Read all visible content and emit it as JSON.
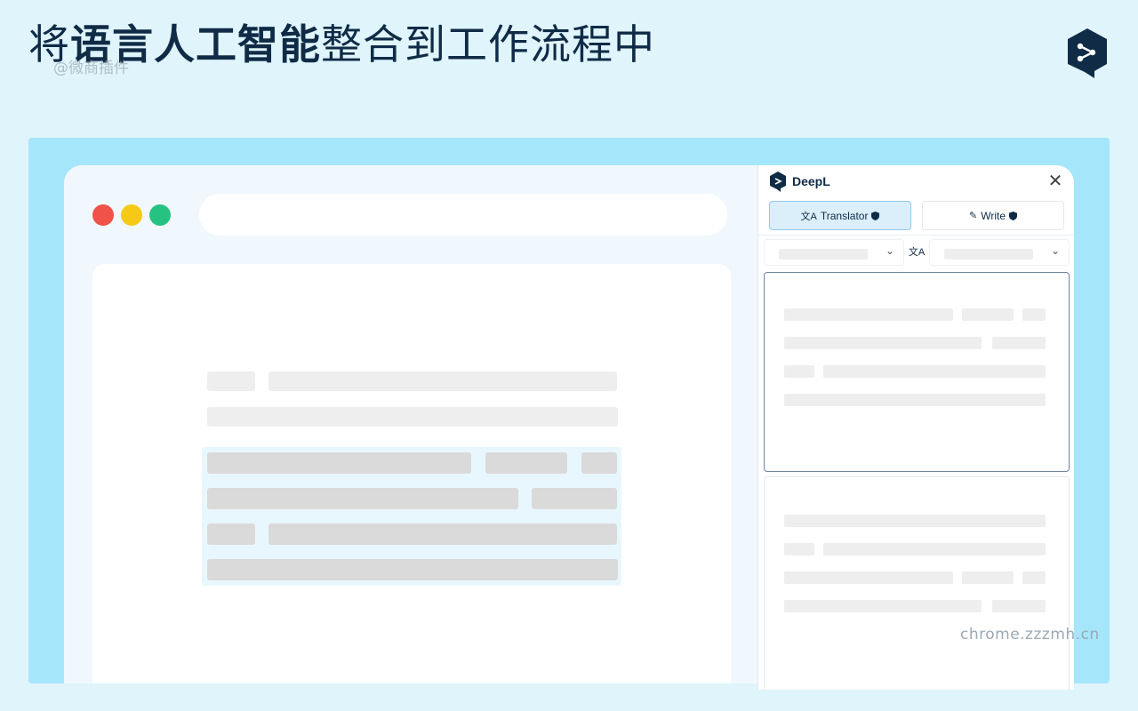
{
  "headline": {
    "part1": "将",
    "part2_bold": "语言人工智能",
    "part3": "整合到工作流程中"
  },
  "watermark_top": "@微商插件",
  "watermark_bottom": "chrome.zzzmh.cn",
  "colors": {
    "background": "#dff4fb",
    "stage": "#a6e6fb",
    "brand_navy": "#0f2b46",
    "traffic_red": "#f0524a",
    "traffic_yellow": "#f6c915",
    "traffic_green": "#26c281",
    "highlight": "#e8f7fd"
  },
  "icons": {
    "brand_logo": "deepl-logo-icon",
    "close": "close-icon",
    "translator": "translate-icon",
    "write": "magic-wand-icon",
    "shield": "shield-check-icon",
    "chevron": "chevron-down-icon",
    "swap": "swap-languages-icon"
  },
  "panel": {
    "app_name": "DeepL",
    "close_glyph": "✕",
    "tabs": [
      {
        "label": "Translator",
        "active": true
      },
      {
        "label": "Write",
        "active": false
      }
    ],
    "chevron_glyph": "⌄",
    "swap_glyph": "文A"
  }
}
